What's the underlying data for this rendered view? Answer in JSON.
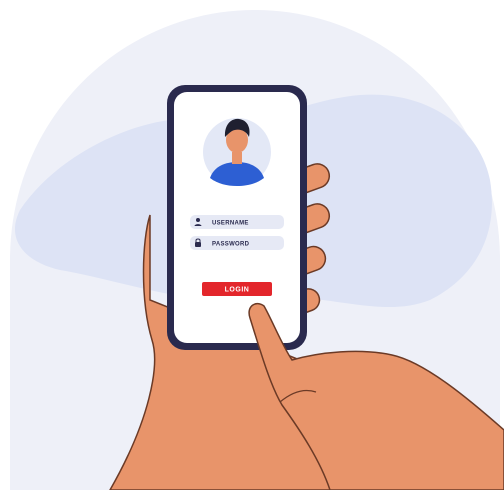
{
  "illustration": {
    "username_placeholder": "USERNAME",
    "password_placeholder": "PASSWORD",
    "login_label": "LOGIN",
    "colors": {
      "backdrop": "#eef0f8",
      "blob": "#dde3f5",
      "phone_frame": "#2a2a4e",
      "screen": "#ffffff",
      "avatar_bg": "#e3e8f6",
      "shirt": "#2d5fd3",
      "skin": "#e8946a",
      "hair": "#1f2030",
      "field": "#e6e9f5",
      "login_button": "#e3262b",
      "outline": "#6b3a26"
    },
    "icons": [
      "user-icon",
      "lock-icon"
    ]
  }
}
